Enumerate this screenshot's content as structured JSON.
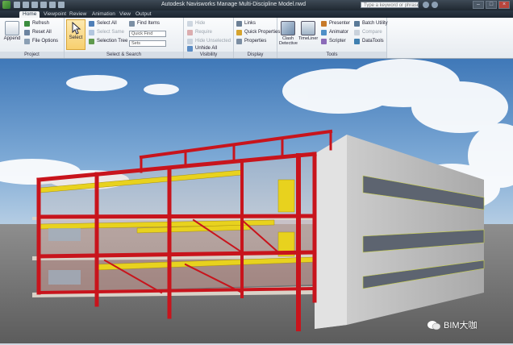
{
  "window": {
    "title": "Autodesk Navisworks Manage       Multi-Discipline Model.nwd",
    "search_placeholder": "Type a keyword or phrase"
  },
  "tabs": [
    {
      "label": "Home",
      "active": true
    },
    {
      "label": "Viewpoint",
      "active": false
    },
    {
      "label": "Review",
      "active": false
    },
    {
      "label": "Animation",
      "active": false
    },
    {
      "label": "View",
      "active": false
    },
    {
      "label": "Output",
      "active": false
    }
  ],
  "ribbon": {
    "project": {
      "label": "Project",
      "append": "Append",
      "refresh": "Refresh",
      "reset_all": "Reset All",
      "file_options": "File Options"
    },
    "select_search": {
      "label": "Select & Search",
      "select": "Select",
      "select_all": "Select All",
      "select_same": "Select Same",
      "selection_tree": "Selection Tree",
      "find_items": "Find Items",
      "quick_find": "Quick Find",
      "sets": "Sets"
    },
    "visibility": {
      "label": "Visibility",
      "hide": "Hide",
      "require": "Require",
      "hide_unselected": "Hide Unselected",
      "unhide_all": "Unhide All"
    },
    "display": {
      "label": "Display",
      "links": "Links",
      "quick_properties": "Quick Properties",
      "properties": "Properties"
    },
    "tools": {
      "label": "Tools",
      "clash_detective": "Clash Detective",
      "timeliner": "TimeLiner",
      "presenter": "Presenter",
      "animator": "Animator",
      "scripter": "Scripter",
      "batch_utility": "Batch Utility",
      "compare": "Compare",
      "datatools": "DataTools"
    }
  },
  "watermark": {
    "text": "BIM大咖"
  },
  "colors": {
    "steel": "#c8141c",
    "duct": "#e8d21e",
    "facade": "#c9c9c9",
    "sky": "#4c86c4"
  }
}
